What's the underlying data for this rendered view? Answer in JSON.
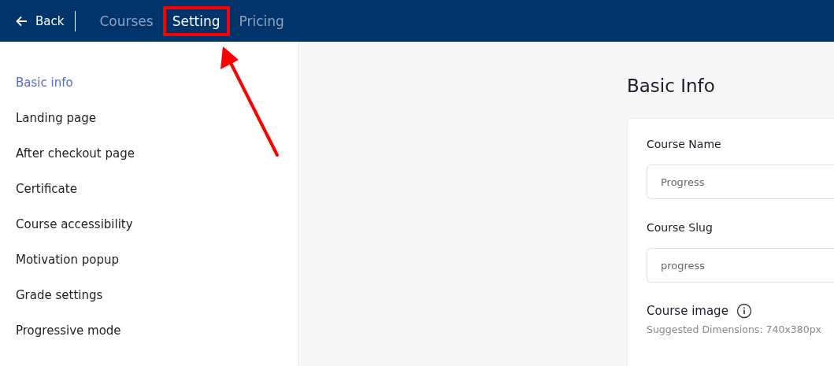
{
  "top_bar": {
    "back": {
      "label": "Back"
    },
    "tabs": [
      {
        "label": "Courses",
        "selected": false,
        "highlighted": false
      },
      {
        "label": "Setting",
        "selected": true,
        "highlighted": true
      },
      {
        "label": "Pricing",
        "selected": false,
        "highlighted": false
      }
    ]
  },
  "sidebar": {
    "items": [
      {
        "label": "Basic info",
        "selected": true
      },
      {
        "label": "Landing page",
        "selected": false
      },
      {
        "label": "After checkout page",
        "selected": false
      },
      {
        "label": "Certificate",
        "selected": false
      },
      {
        "label": "Course accessibility",
        "selected": false
      },
      {
        "label": "Motivation popup",
        "selected": false
      },
      {
        "label": "Grade settings",
        "selected": false
      },
      {
        "label": "Progressive mode",
        "selected": false
      }
    ]
  },
  "main": {
    "title": "Basic Info",
    "fields": [
      {
        "label": "Course Name",
        "value": "Progress"
      },
      {
        "label": "Course Slug",
        "value": "progress"
      }
    ],
    "image": {
      "label": "Course image",
      "hint": "Suggested Dimensions: 740x380px"
    }
  }
}
